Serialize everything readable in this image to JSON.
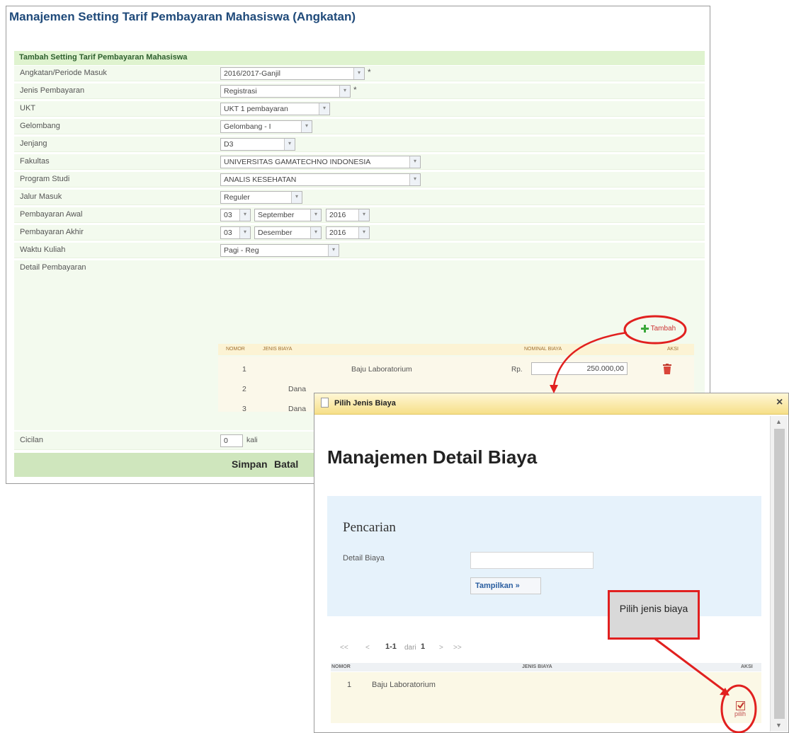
{
  "main": {
    "title": "Manajemen Setting Tarif Pembayaran Mahasiswa (Angkatan)",
    "section_title": "Tambah Setting Tarif Pembayaran Mahasiswa",
    "fields": {
      "angkatan": {
        "label": "Angkatan/Periode Masuk",
        "value": "2016/2017-Ganjil"
      },
      "jenis": {
        "label": "Jenis Pembayaran",
        "value": "Registrasi"
      },
      "ukt": {
        "label": "UKT",
        "value": "UKT 1 pembayaran"
      },
      "gelombang": {
        "label": "Gelombang",
        "value": "Gelombang - I"
      },
      "jenjang": {
        "label": "Jenjang",
        "value": "D3"
      },
      "fakultas": {
        "label": "Fakultas",
        "value": "UNIVERSITAS GAMATECHNO INDONESIA"
      },
      "prodi": {
        "label": "Program Studi",
        "value": "ANALIS KESEHATAN"
      },
      "jalur": {
        "label": "Jalur Masuk",
        "value": "Reguler"
      },
      "awal": {
        "label": "Pembayaran Awal",
        "day": "03",
        "month": "September",
        "year": "2016"
      },
      "akhir": {
        "label": "Pembayaran Akhir",
        "day": "03",
        "month": "Desember",
        "year": "2016"
      },
      "waktu": {
        "label": "Waktu Kuliah",
        "value": "Pagi - Reg"
      },
      "detail": {
        "label": "Detail Pembayaran"
      },
      "cicilan": {
        "label": "Cicilan",
        "value": "0",
        "suffix": "kali"
      }
    },
    "required_mark": "*",
    "tambah_label": "Tambah",
    "detail_table": {
      "headers": {
        "nomor": "NOMOR",
        "jenis": "JENIS BIAYA",
        "nominal": "NOMINAL BIAYA",
        "aksi": "AKSI"
      },
      "rows": [
        {
          "no": "1",
          "jenis": "Baju Laboratorium",
          "currency": "Rp.",
          "nominal": "250.000,00"
        },
        {
          "no": "2",
          "jenis": "Dana"
        },
        {
          "no": "3",
          "jenis": "Dana"
        }
      ]
    },
    "buttons": {
      "simpan": "Simpan",
      "batal": "Batal"
    }
  },
  "popup": {
    "title": "Pilih Jenis Biaya",
    "close": "×",
    "heading": "Manajemen Detail Biaya",
    "search_title": "Pencarian",
    "search_label": "Detail Biaya",
    "search_value": "",
    "tampilkan": "Tampilkan »",
    "pager": {
      "first": "<<",
      "prev": "<",
      "range": "1-1",
      "of": "dari",
      "total": "1",
      "next": ">",
      "last": ">>"
    },
    "list_headers": {
      "nomor": "NOMOR",
      "jenis": "JENIS BIAYA",
      "aksi": "AKSI"
    },
    "list_rows": [
      {
        "no": "1",
        "jenis": "Baju Laboratorium",
        "action": "pilih"
      }
    ]
  },
  "annotation": {
    "callout": "Pilih jenis biaya"
  }
}
